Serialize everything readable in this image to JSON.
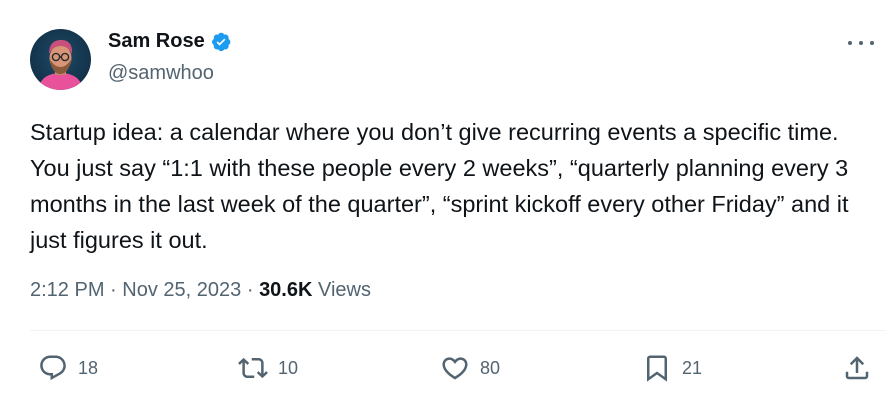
{
  "author": {
    "display_name": "Sam Rose",
    "handle": "@samwhoo",
    "verified": true,
    "verified_color": "#1d9bf0"
  },
  "tweet": {
    "text": "Startup idea: a calendar where you don’t give recurring events a specific time. You just say “1:1 with these people every 2 weeks”, “quarterly planning every 3 months in the last week of the quarter”, “sprint kickoff every other Friday” and it just figures it out.",
    "time": "2:12 PM",
    "separator": "·",
    "date": "Nov 25, 2023",
    "views_count": "30.6K",
    "views_label": "Views"
  },
  "actions": {
    "replies": "18",
    "retweets": "10",
    "likes": "80",
    "bookmarks": "21"
  },
  "icons": {
    "more": "more-icon",
    "reply": "reply-icon",
    "retweet": "retweet-icon",
    "like": "heart-icon",
    "bookmark": "bookmark-icon",
    "share": "share-icon"
  },
  "colors": {
    "text_primary": "#0f1419",
    "text_secondary": "#536471",
    "divider": "#eff3f4"
  }
}
